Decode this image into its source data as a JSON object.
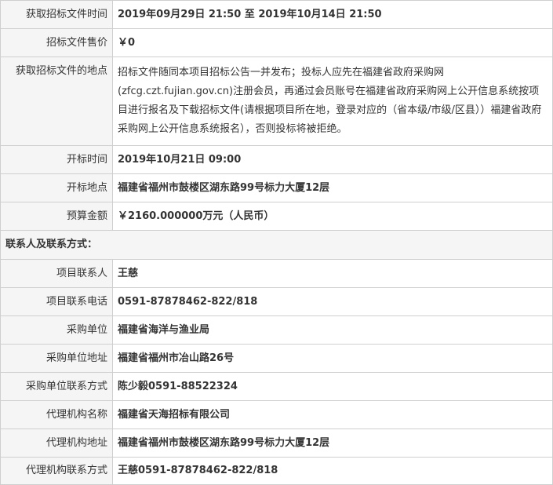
{
  "rows": [
    {
      "label": "获取招标文件时间",
      "value": "2019年09月29日 21:50  至  2019年10月14日 21:50"
    },
    {
      "label": "招标文件售价",
      "value": "￥0"
    },
    {
      "label": "获取招标文件的地点",
      "value": "招标文件随同本项目招标公告一并发布；投标人应先在福建省政府采购网(zfcg.czt.fujian.gov.cn)注册会员，再通过会员账号在福建省政府采购网上公开信息系统按项目进行报名及下载招标文件(请根据项目所在地，登录对应的（省本级/市级/区县））福建省政府采购网上公开信息系统报名），否则投标将被拒绝。"
    },
    {
      "label": "开标时间",
      "value": "2019年10月21日 09:00"
    },
    {
      "label": "开标地点",
      "value": "福建省福州市鼓楼区湖东路99号标力大厦12层"
    },
    {
      "label": "预算金额",
      "value": "￥2160.000000万元（人民币）"
    }
  ],
  "contact_section": {
    "title": "联系人及联系方式："
  },
  "contacts": [
    {
      "label": "项目联系人",
      "value": "王慈"
    },
    {
      "label": "项目联系电话",
      "value": "0591-87878462-822/818"
    },
    {
      "label": "采购单位",
      "value": "福建省海洋与渔业局"
    },
    {
      "label": "采购单位地址",
      "value": "福建省福州市冶山路26号"
    },
    {
      "label": "采购单位联系方式",
      "value": "陈少毅0591-88522324"
    },
    {
      "label": "代理机构名称",
      "value": "福建省天海招标有限公司"
    },
    {
      "label": "代理机构地址",
      "value": "福建省福州市鼓楼区湖东路99号标力大厦12层"
    },
    {
      "label": "代理机构联系方式",
      "value": "王慈0591-87878462-822/818"
    }
  ]
}
